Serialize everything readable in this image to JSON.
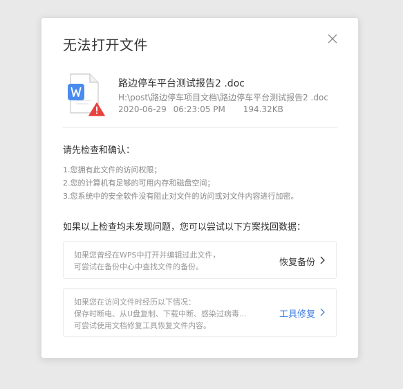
{
  "dialog": {
    "title": "无法打开文件"
  },
  "file": {
    "name": "路边停车平台测试报告2 .doc",
    "path": "H:\\post\\路边停车项目文档\\路边停车平台测试报告2 .doc",
    "date": "2020-06-29",
    "time": "06:23:05 PM",
    "size": "194.32KB",
    "icon_letter": "W"
  },
  "check": {
    "heading": "请先检查和确认：",
    "items": [
      "1.您拥有此文件的访问权限；",
      "2.您的计算机有足够的可用内存和磁盘空间；",
      "3.您系统中的安全软件没有阻止对文件的访问或对文件内容进行加密。"
    ]
  },
  "fix": {
    "heading": "如果以上检查均未发现问题，您可以尝试以下方案找回数据：",
    "backup": {
      "lines": [
        "如果您曾经在WPS中打开并编辑过此文件，",
        "可尝试在备份中心中查找文件的备份。"
      ],
      "action": "恢复备份"
    },
    "repair": {
      "lines": [
        "如果您在访问文件时经历以下情况：",
        "保存时断电、从U盘复制、下载中断、感染过病毒...",
        "可尝试使用文档修复工具恢复文件内容。"
      ],
      "action": "工具修复"
    }
  },
  "colors": {
    "accent": "#3f7fe0",
    "word_blue": "#4a8bf0",
    "warning_red": "#e8433e"
  }
}
